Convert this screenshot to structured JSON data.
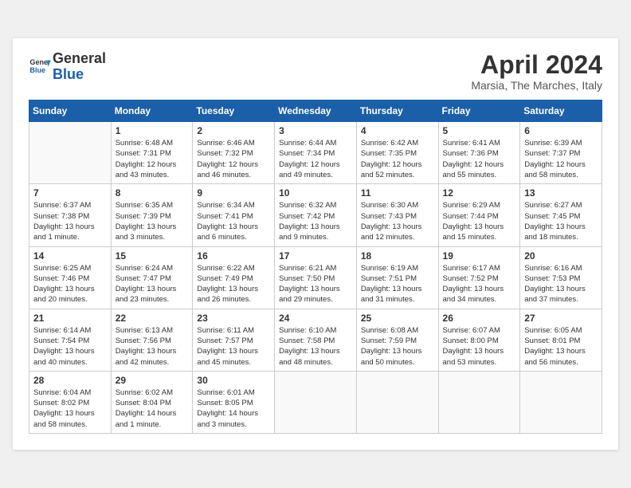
{
  "header": {
    "logo_text_general": "General",
    "logo_text_blue": "Blue",
    "title": "April 2024",
    "subtitle": "Marsia, The Marches, Italy"
  },
  "days_of_week": [
    "Sunday",
    "Monday",
    "Tuesday",
    "Wednesday",
    "Thursday",
    "Friday",
    "Saturday"
  ],
  "weeks": [
    [
      {
        "day": null,
        "data": null
      },
      {
        "day": "1",
        "data": "Sunrise: 6:48 AM\nSunset: 7:31 PM\nDaylight: 12 hours\nand 43 minutes."
      },
      {
        "day": "2",
        "data": "Sunrise: 6:46 AM\nSunset: 7:32 PM\nDaylight: 12 hours\nand 46 minutes."
      },
      {
        "day": "3",
        "data": "Sunrise: 6:44 AM\nSunset: 7:34 PM\nDaylight: 12 hours\nand 49 minutes."
      },
      {
        "day": "4",
        "data": "Sunrise: 6:42 AM\nSunset: 7:35 PM\nDaylight: 12 hours\nand 52 minutes."
      },
      {
        "day": "5",
        "data": "Sunrise: 6:41 AM\nSunset: 7:36 PM\nDaylight: 12 hours\nand 55 minutes."
      },
      {
        "day": "6",
        "data": "Sunrise: 6:39 AM\nSunset: 7:37 PM\nDaylight: 12 hours\nand 58 minutes."
      }
    ],
    [
      {
        "day": "7",
        "data": "Sunrise: 6:37 AM\nSunset: 7:38 PM\nDaylight: 13 hours\nand 1 minute."
      },
      {
        "day": "8",
        "data": "Sunrise: 6:35 AM\nSunset: 7:39 PM\nDaylight: 13 hours\nand 3 minutes."
      },
      {
        "day": "9",
        "data": "Sunrise: 6:34 AM\nSunset: 7:41 PM\nDaylight: 13 hours\nand 6 minutes."
      },
      {
        "day": "10",
        "data": "Sunrise: 6:32 AM\nSunset: 7:42 PM\nDaylight: 13 hours\nand 9 minutes."
      },
      {
        "day": "11",
        "data": "Sunrise: 6:30 AM\nSunset: 7:43 PM\nDaylight: 13 hours\nand 12 minutes."
      },
      {
        "day": "12",
        "data": "Sunrise: 6:29 AM\nSunset: 7:44 PM\nDaylight: 13 hours\nand 15 minutes."
      },
      {
        "day": "13",
        "data": "Sunrise: 6:27 AM\nSunset: 7:45 PM\nDaylight: 13 hours\nand 18 minutes."
      }
    ],
    [
      {
        "day": "14",
        "data": "Sunrise: 6:25 AM\nSunset: 7:46 PM\nDaylight: 13 hours\nand 20 minutes."
      },
      {
        "day": "15",
        "data": "Sunrise: 6:24 AM\nSunset: 7:47 PM\nDaylight: 13 hours\nand 23 minutes."
      },
      {
        "day": "16",
        "data": "Sunrise: 6:22 AM\nSunset: 7:49 PM\nDaylight: 13 hours\nand 26 minutes."
      },
      {
        "day": "17",
        "data": "Sunrise: 6:21 AM\nSunset: 7:50 PM\nDaylight: 13 hours\nand 29 minutes."
      },
      {
        "day": "18",
        "data": "Sunrise: 6:19 AM\nSunset: 7:51 PM\nDaylight: 13 hours\nand 31 minutes."
      },
      {
        "day": "19",
        "data": "Sunrise: 6:17 AM\nSunset: 7:52 PM\nDaylight: 13 hours\nand 34 minutes."
      },
      {
        "day": "20",
        "data": "Sunrise: 6:16 AM\nSunset: 7:53 PM\nDaylight: 13 hours\nand 37 minutes."
      }
    ],
    [
      {
        "day": "21",
        "data": "Sunrise: 6:14 AM\nSunset: 7:54 PM\nDaylight: 13 hours\nand 40 minutes."
      },
      {
        "day": "22",
        "data": "Sunrise: 6:13 AM\nSunset: 7:56 PM\nDaylight: 13 hours\nand 42 minutes."
      },
      {
        "day": "23",
        "data": "Sunrise: 6:11 AM\nSunset: 7:57 PM\nDaylight: 13 hours\nand 45 minutes."
      },
      {
        "day": "24",
        "data": "Sunrise: 6:10 AM\nSunset: 7:58 PM\nDaylight: 13 hours\nand 48 minutes."
      },
      {
        "day": "25",
        "data": "Sunrise: 6:08 AM\nSunset: 7:59 PM\nDaylight: 13 hours\nand 50 minutes."
      },
      {
        "day": "26",
        "data": "Sunrise: 6:07 AM\nSunset: 8:00 PM\nDaylight: 13 hours\nand 53 minutes."
      },
      {
        "day": "27",
        "data": "Sunrise: 6:05 AM\nSunset: 8:01 PM\nDaylight: 13 hours\nand 56 minutes."
      }
    ],
    [
      {
        "day": "28",
        "data": "Sunrise: 6:04 AM\nSunset: 8:02 PM\nDaylight: 13 hours\nand 58 minutes."
      },
      {
        "day": "29",
        "data": "Sunrise: 6:02 AM\nSunset: 8:04 PM\nDaylight: 14 hours\nand 1 minute."
      },
      {
        "day": "30",
        "data": "Sunrise: 6:01 AM\nSunset: 8:05 PM\nDaylight: 14 hours\nand 3 minutes."
      },
      {
        "day": null,
        "data": null
      },
      {
        "day": null,
        "data": null
      },
      {
        "day": null,
        "data": null
      },
      {
        "day": null,
        "data": null
      }
    ]
  ]
}
